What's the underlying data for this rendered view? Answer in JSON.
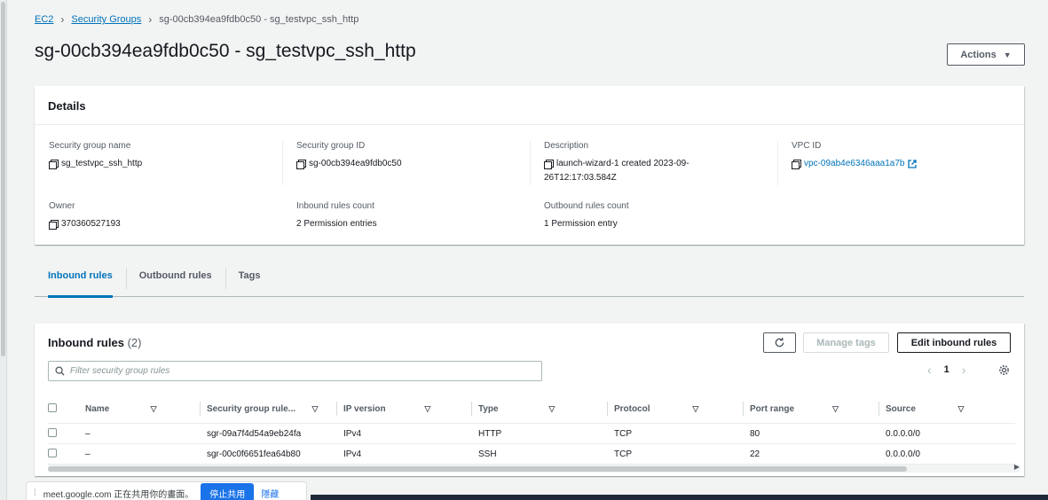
{
  "breadcrumb": {
    "ec2": "EC2",
    "security_groups": "Security Groups",
    "current": "sg-00cb394ea9fdb0c50 - sg_testvpc_ssh_http"
  },
  "page_title": "sg-00cb394ea9fdb0c50 - sg_testvpc_ssh_http",
  "actions_label": "Actions",
  "details": {
    "title": "Details",
    "sg_name_label": "Security group name",
    "sg_name": "sg_testvpc_ssh_http",
    "sg_id_label": "Security group ID",
    "sg_id": "sg-00cb394ea9fdb0c50",
    "desc_label": "Description",
    "desc_line1": "launch-wizard-1 created 2023-09-",
    "desc_line2": "26T12:17:03.584Z",
    "vpc_label": "VPC ID",
    "vpc_id": "vpc-09ab4e6346aaa1a7b",
    "owner_label": "Owner",
    "owner": "370360527193",
    "inbound_count_label": "Inbound rules count",
    "inbound_count": "2 Permission entries",
    "outbound_count_label": "Outbound rules count",
    "outbound_count": "1 Permission entry"
  },
  "tabs": [
    "Inbound rules",
    "Outbound rules",
    "Tags"
  ],
  "inbound": {
    "title": "Inbound rules",
    "count": "(2)",
    "manage_tags": "Manage tags",
    "edit_inbound": "Edit inbound rules",
    "search_placeholder": "Filter security group rules",
    "page": "1",
    "columns": [
      "Name",
      "Security group rule...",
      "IP version",
      "Type",
      "Protocol",
      "Port range",
      "Source"
    ],
    "rows": [
      {
        "name": "–",
        "rule_id": "sgr-09a7f4d54a9eb24fa",
        "ip": "IPv4",
        "type": "HTTP",
        "protocol": "TCP",
        "port": "80",
        "source": "0.0.0.0/0"
      },
      {
        "name": "–",
        "rule_id": "sgr-00c0f6651fea64b80",
        "ip": "IPv4",
        "type": "SSH",
        "protocol": "TCP",
        "port": "22",
        "source": "0.0.0.0/0"
      }
    ]
  },
  "share_bar": {
    "text": "meet.google.com 正在共用你的畫面。",
    "stop": "停止共用",
    "hide": "隱藏"
  },
  "colors": {
    "link": "#0073bb",
    "text": "#16191f",
    "muted": "#545b64",
    "share_blue": "#1a73e8"
  }
}
